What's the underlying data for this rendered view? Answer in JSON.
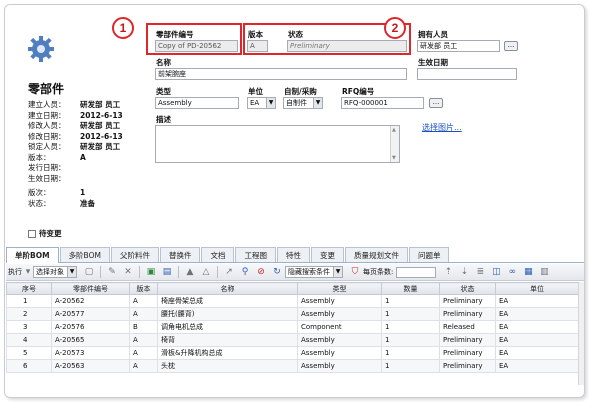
{
  "left_panel": {
    "title": "零部件",
    "meta": [
      {
        "k": "建立人员：",
        "v": "研发部 员工"
      },
      {
        "k": "建立日期：",
        "v": "2012-6-13"
      },
      {
        "k": "修改人员：",
        "v": "研发部 员工"
      },
      {
        "k": "修改日期：",
        "v": "2012-6-13"
      },
      {
        "k": "锁定人员：",
        "v": "研发部 员工"
      },
      {
        "k": "版本：",
        "v": "A"
      },
      {
        "k": "发行日期：",
        "v": ""
      },
      {
        "k": "生效日期：",
        "v": ""
      },
      {
        "k": "版次：",
        "v": "1"
      },
      {
        "k": "状态：",
        "v": "准备"
      }
    ],
    "pending_change_label": "待变更"
  },
  "form": {
    "part_number_label": "零部件编号",
    "part_number_value": "Copy of PD-20562",
    "version_label": "版本",
    "version_value": "A",
    "status_label": "状态",
    "status_value": "Preliminary",
    "owner_label": "拥有人员",
    "owner_value": "研发部 员工",
    "effective_date_label": "生效日期",
    "name_label": "名称",
    "name_value": "前架腕座",
    "type_label": "类型",
    "type_value": "Assembly",
    "unit_label": "单位",
    "unit_value": "EA",
    "make_buy_label": "自制/采购",
    "make_buy_value": "自制件",
    "rfq_label": "RFQ编号",
    "rfq_value": "RFQ-000001",
    "description_label": "描述",
    "select_image_link": "选择图片...",
    "ellipsis": "..."
  },
  "callouts": {
    "one": "1",
    "two": "2"
  },
  "tabs": [
    {
      "label": "单阶BOM",
      "active": true
    },
    {
      "label": "多阶BOM"
    },
    {
      "label": "父阶料件"
    },
    {
      "label": "替换件"
    },
    {
      "label": "文档"
    },
    {
      "label": "工程图"
    },
    {
      "label": "特性"
    },
    {
      "label": "变更"
    },
    {
      "label": "质量规划文件"
    },
    {
      "label": "问题单"
    }
  ],
  "toolbar": {
    "execute_label": "执行",
    "select_object_value": "选择对象",
    "hidden_search_value": "隐藏搜索条件",
    "per_page_label": "每页条数:"
  },
  "table": {
    "columns": [
      "序号",
      "零部件编号",
      "版本",
      "名称",
      "类型",
      "数量",
      "状态",
      "单位"
    ],
    "rows": [
      [
        "1",
        "A-20562",
        "A",
        "椅座骨架总成",
        "Assembly",
        "1",
        "Preliminary",
        "EA"
      ],
      [
        "2",
        "A-20577",
        "A",
        "腰托(腰背)",
        "Assembly",
        "1",
        "Preliminary",
        "EA"
      ],
      [
        "3",
        "A-20576",
        "B",
        "调角电机总成",
        "Component",
        "1",
        "Released",
        "EA"
      ],
      [
        "4",
        "A-20565",
        "A",
        "椅背",
        "Assembly",
        "1",
        "Preliminary",
        "EA"
      ],
      [
        "5",
        "A-20573",
        "A",
        "滑板&升降机构总成",
        "Assembly",
        "1",
        "Preliminary",
        "EA"
      ],
      [
        "6",
        "A-20563",
        "A",
        "头枕",
        "Assembly",
        "1",
        "Preliminary",
        "EA"
      ]
    ]
  },
  "colors": {
    "callout_red": "#e0262b",
    "link_blue": "#1a4fc0"
  }
}
